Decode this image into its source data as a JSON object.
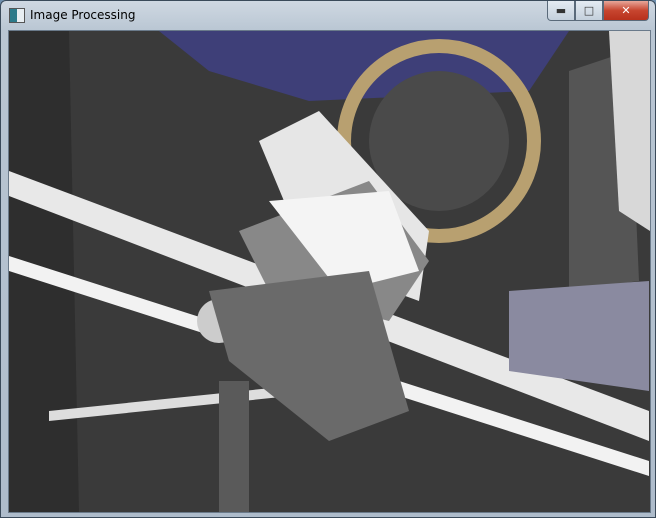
{
  "window": {
    "title": "Image Processing",
    "icon": "opencv-window-icon",
    "controls": {
      "minimize": "minimize-icon",
      "maximize": "maximize-icon",
      "close": "close-icon"
    }
  },
  "image": {
    "description_icon": "posterized-machine-image"
  },
  "colors": {
    "titlebar": "#c3cfdb",
    "close": "#c7452f"
  }
}
